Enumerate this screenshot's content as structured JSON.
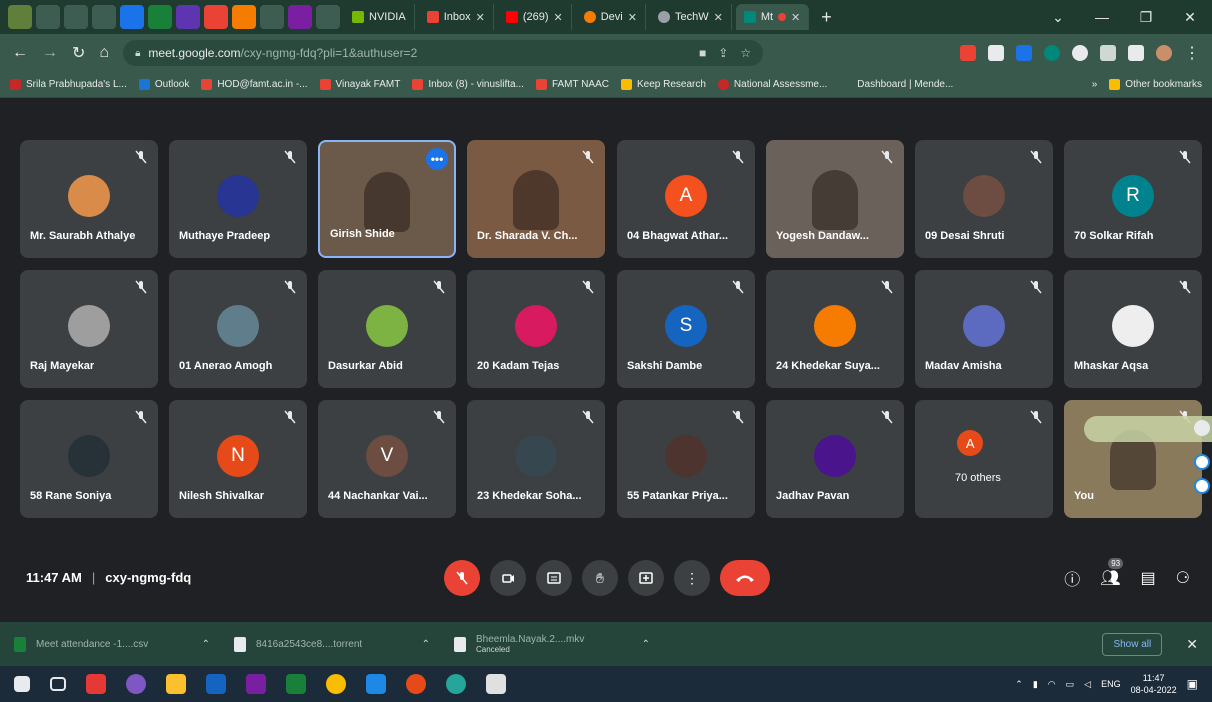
{
  "browser": {
    "tabs": [
      {
        "label": "NVIDIA",
        "color": "#76b900"
      },
      {
        "label": "Inbox",
        "color": "#ea4335"
      },
      {
        "label": "(269)",
        "color": "#ff0000"
      },
      {
        "label": "Devi",
        "color": "#f57c00"
      },
      {
        "label": "TechW",
        "color": "#9aa0a6"
      },
      {
        "label": "Mt",
        "color": "#00897b"
      }
    ],
    "url_host": "meet.google.com",
    "url_path": "/cxy-ngmg-fdq?pli=1&authuser=2",
    "bookmarks": [
      {
        "label": "Srila Prabhupada's L...",
        "color": "#c62828"
      },
      {
        "label": "Outlook",
        "color": "#1976d2"
      },
      {
        "label": "HOD@famt.ac.in -...",
        "color": "#ea4335"
      },
      {
        "label": "Vinayak FAMT",
        "color": "#ea4335"
      },
      {
        "label": "Inbox (8) - vinuslifta...",
        "color": "#ea4335"
      },
      {
        "label": "FAMT NAAC",
        "color": "#ea4335"
      },
      {
        "label": "Keep Research",
        "color": "#fbbc04"
      },
      {
        "label": "National Assessme...",
        "color": "#c62828"
      },
      {
        "label": "Dashboard | Mende...",
        "color": "#9aa0a6"
      },
      {
        "label": "Other bookmarks",
        "color": "#fbbc04"
      }
    ]
  },
  "participants": [
    {
      "name": "Mr. Saurabh Athalye",
      "avatar_color": "#d98c4a",
      "initial": ""
    },
    {
      "name": "Muthaye Pradeep",
      "avatar_color": "#283593",
      "initial": ""
    },
    {
      "name": "Girish Shide",
      "avatar_color": "",
      "initial": ""
    },
    {
      "name": "Dr. Sharada V. Ch...",
      "avatar_color": "",
      "initial": ""
    },
    {
      "name": "04 Bhagwat Athar...",
      "avatar_color": "#f4511e",
      "initial": "A"
    },
    {
      "name": "Yogesh Dandaw...",
      "avatar_color": "",
      "initial": ""
    },
    {
      "name": "09 Desai Shruti",
      "avatar_color": "#6d4c41",
      "initial": ""
    },
    {
      "name": "70 Solkar Rifah",
      "avatar_color": "#00838f",
      "initial": "R"
    },
    {
      "name": "Raj Mayekar",
      "avatar_color": "#9e9e9e",
      "initial": ""
    },
    {
      "name": "01 Anerao Amogh",
      "avatar_color": "#607d8b",
      "initial": ""
    },
    {
      "name": "Dasurkar Abid",
      "avatar_color": "#7cb342",
      "initial": ""
    },
    {
      "name": "20 Kadam Tejas",
      "avatar_color": "#d81b60",
      "initial": ""
    },
    {
      "name": "Sakshi Dambe",
      "avatar_color": "#1565c0",
      "initial": "S"
    },
    {
      "name": "24 Khedekar Suya...",
      "avatar_color": "#f57c00",
      "initial": ""
    },
    {
      "name": "Madav Amisha",
      "avatar_color": "#5c6bc0",
      "initial": ""
    },
    {
      "name": "Mhaskar Aqsa",
      "avatar_color": "#eeeeee",
      "initial": ""
    },
    {
      "name": "58 Rane Soniya",
      "avatar_color": "#263238",
      "initial": ""
    },
    {
      "name": "Nilesh Shivalkar",
      "avatar_color": "#e64a19",
      "initial": "N"
    },
    {
      "name": "44 Nachankar Vai...",
      "avatar_color": "#6d4c41",
      "initial": "V"
    },
    {
      "name": "23 Khedekar Soha...",
      "avatar_color": "#37474f",
      "initial": ""
    },
    {
      "name": "55 Patankar Priya...",
      "avatar_color": "#4e342e",
      "initial": ""
    },
    {
      "name": "Jadhav Pavan",
      "avatar_color": "#4a148c",
      "initial": ""
    },
    {
      "name": "70 others",
      "avatar_color": "#e64a19",
      "initial": "A"
    },
    {
      "name": "You",
      "avatar_color": "",
      "initial": ""
    }
  ],
  "meeting": {
    "time": "11:47 AM",
    "separator": "|",
    "code": "cxy-ngmg-fdq",
    "people_count": "93"
  },
  "downloads": [
    {
      "name": "Meet attendance -1....csv",
      "sub": ""
    },
    {
      "name": "8416a2543ce8....torrent",
      "sub": ""
    },
    {
      "name": "Bheemla.Nayak.2....mkv",
      "sub": "Canceled"
    }
  ],
  "downloads_bar": {
    "show_all": "Show all"
  },
  "taskbar": {
    "lang": "ENG",
    "time": "11:47",
    "date": "08-04-2022"
  }
}
